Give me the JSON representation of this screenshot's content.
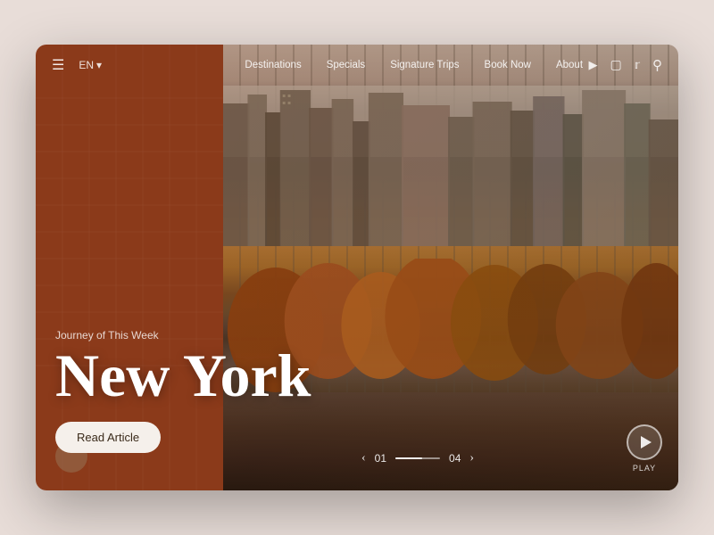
{
  "nav": {
    "hamburger_label": "☰",
    "lang": "EN",
    "lang_arrow": "▾",
    "links": [
      {
        "label": "Destinations",
        "id": "destinations"
      },
      {
        "label": "Specials",
        "id": "specials"
      },
      {
        "label": "Signature Trips",
        "id": "signature-trips"
      },
      {
        "label": "Book Now",
        "id": "book-now"
      },
      {
        "label": "About",
        "id": "about"
      }
    ],
    "icons": [
      {
        "name": "youtube-icon",
        "symbol": "▶"
      },
      {
        "name": "instagram-icon",
        "symbol": "◻"
      },
      {
        "name": "twitter-icon",
        "symbol": "✦"
      },
      {
        "name": "search-icon",
        "symbol": "⌕"
      }
    ]
  },
  "hero": {
    "journey_label": "Journey of This Week",
    "city": "New York",
    "read_article_label": "Read Article"
  },
  "pagination": {
    "prev_arrow": "‹",
    "current": "01",
    "total": "04",
    "next_arrow": "›"
  },
  "play": {
    "label": "PLAY"
  },
  "colors": {
    "sidebar_bg": "#8B3A1A",
    "btn_bg": "#f2ece6",
    "btn_text": "#3a2a1a"
  }
}
